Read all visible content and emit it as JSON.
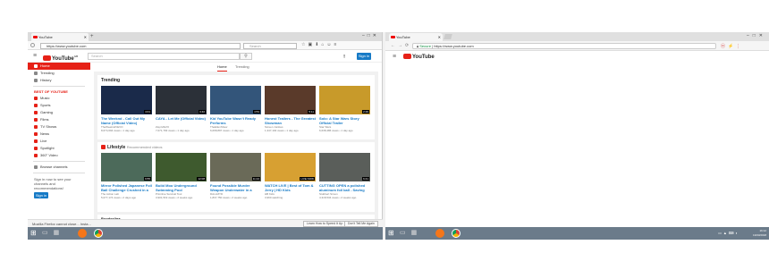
{
  "left_window": {
    "tab_title": "YouTube",
    "url": "https://www.youtube.com",
    "search_placeholder": "Search",
    "yt_logo": "YouTube",
    "yt_logo_suffix": "GB",
    "search_field_placeholder": "Search",
    "signin_label": "Sign in",
    "sidebar": {
      "items": [
        {
          "label": "Home",
          "active": true
        },
        {
          "label": "Trending",
          "active": false
        },
        {
          "label": "History",
          "active": false
        }
      ],
      "best_heading": "BEST OF YOUTUBE",
      "best_items": [
        "Music",
        "Sports",
        "Gaming",
        "Films",
        "TV Shows",
        "News",
        "Live",
        "Spotlight",
        "360° Video"
      ],
      "browse_channels": "Browse channels",
      "signin_note": "Sign in now to see your channels and recommendations!",
      "signin_button": "Sign in"
    },
    "content_tabs": [
      "Home",
      "Trending"
    ],
    "trending": {
      "title": "Trending",
      "cards": [
        {
          "title": "The Weeknd - Call Out My Name (Official Video)",
          "channel": "TheWeekndVEVO",
          "meta": "8,674,694 views • 1 day ago",
          "duration": "4:01",
          "color": "#1a2a4a"
        },
        {
          "title": "CAYA - Let Me (Official Video)",
          "channel": "ZaynVEVO",
          "meta": "7,071,793 views • 1 day ago",
          "duration": "3:40",
          "color": "#2b3038"
        },
        {
          "title": "Kid YouTube Wasn't Ready Performs",
          "channel": "TheEllenShow",
          "meta": "6,068,897 views • 1 day ago",
          "duration": "4:53",
          "color": "#33557a"
        },
        {
          "title": "Honest Trailers - The Greatest Showman",
          "channel": "Screen Junkies",
          "meta": "1,347,102 views • 1 day ago",
          "duration": "5:11",
          "color": "#5a3a2a"
        },
        {
          "title": "Solo: A Star Wars Story Official Trailer",
          "channel": "Star Wars",
          "meta": "6,638,486 views • 1 day ago",
          "duration": "2:29",
          "color": "#c89a2a"
        }
      ]
    },
    "lifestyle": {
      "title": "Lifestyle",
      "subtitle": "Recommended videos",
      "cards": [
        {
          "title": "Mirror Polished Japanese Foil Ball Challenge Crushed in a",
          "channel": "The Action Lab",
          "meta": "5,077,174 views • 2 days ago",
          "duration": "9:55",
          "color": "#4c6a5a"
        },
        {
          "title": "Build Moo Underground Swimming Pool",
          "channel": "Primitive Survival Tool",
          "meta": "3,901,519 views • 2 weeks ago",
          "duration": "12:08",
          "color": "#3e5a2e"
        },
        {
          "title": "Found Possible Murder Weapon Underwater in a Shallow Under...",
          "channel": "DALLMYD",
          "meta": "1,837,750 views • 2 weeks ago",
          "duration": "11:24",
          "color": "#6a6a58"
        },
        {
          "title": "WATCH LIVE | Best of Tom & Jerry | HD Kids",
          "channel": "HB Kids",
          "meta": "3,960 watching",
          "duration": "LIVE NOW",
          "color": "#d7a032"
        },
        {
          "title": "CUTTING OPEN a polished aluminum foil ball - Saving and ...",
          "channel": "Stubbert Simon",
          "meta": "4,318,534 views • 2 weeks ago",
          "duration": "6:41",
          "color": "#5a5e5a"
        }
      ]
    },
    "next_section_title": "Bundesliga",
    "status_text": "Mozilla Firefox cannot close... Insta...",
    "status_pills": [
      "Learn How to Speed It Up",
      "Don't Tell Me Again"
    ]
  },
  "right_window": {
    "tab_title": "YouTube",
    "url_secure": "Secure",
    "url": "https://www.youtube.com",
    "yt_logo": "YouTube"
  },
  "taskbar": {
    "clock_time": "16:12",
    "clock_date": "13/03/2018"
  }
}
